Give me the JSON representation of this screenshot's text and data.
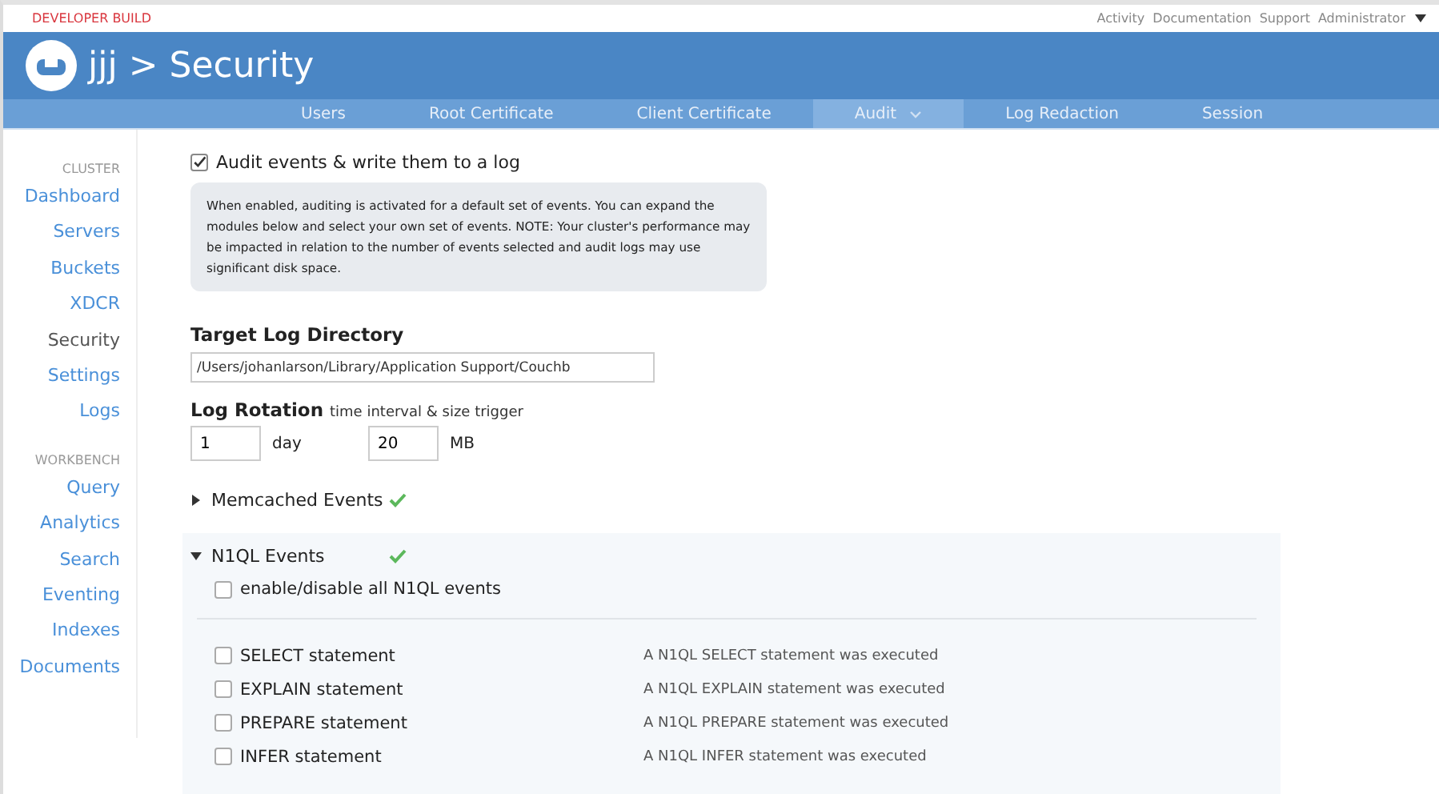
{
  "top_bar": {
    "badge": "DEVELOPER BUILD",
    "links": [
      "Activity",
      "Documentation",
      "Support",
      "Administrator"
    ]
  },
  "header": {
    "title": "jjj > Security"
  },
  "tabs": [
    {
      "label": "Users",
      "selected": false,
      "dropdown": false
    },
    {
      "label": "Root Certificate",
      "selected": false,
      "dropdown": false
    },
    {
      "label": "Client Certificate",
      "selected": false,
      "dropdown": false
    },
    {
      "label": "Audit",
      "selected": true,
      "dropdown": true
    },
    {
      "label": "Log Redaction",
      "selected": false,
      "dropdown": false
    },
    {
      "label": "Session",
      "selected": false,
      "dropdown": false
    }
  ],
  "sidebar": {
    "groups": [
      {
        "heading": "CLUSTER",
        "items": [
          {
            "label": "Dashboard",
            "selected": false
          },
          {
            "label": "Servers",
            "selected": false
          },
          {
            "label": "Buckets",
            "selected": false
          },
          {
            "label": "XDCR",
            "selected": false
          },
          {
            "label": "Security",
            "selected": true
          },
          {
            "label": "Settings",
            "selected": false
          },
          {
            "label": "Logs",
            "selected": false
          }
        ]
      },
      {
        "heading": "WORKBENCH",
        "items": [
          {
            "label": "Query",
            "selected": false
          },
          {
            "label": "Analytics",
            "selected": false
          },
          {
            "label": "Search",
            "selected": false
          },
          {
            "label": "Eventing",
            "selected": false
          },
          {
            "label": "Indexes",
            "selected": false
          },
          {
            "label": "Documents",
            "selected": false
          }
        ]
      }
    ]
  },
  "audit": {
    "label": "Audit events & write them to a log",
    "checked": true,
    "note": "When enabled, auditing is activated for a default set of events. You can expand the modules below and select your own set of events. NOTE: Your cluster's performance may be impacted in relation to the number of events selected and audit logs may use significant disk space."
  },
  "target_log_directory": {
    "label": "Target Log Directory",
    "value": "/Users/johanlarson/Library/Application Support/Couchb"
  },
  "log_rotation": {
    "label": "Log Rotation",
    "hint": "time interval & size trigger",
    "interval": "1",
    "interval_unit": "day",
    "size": "20",
    "size_unit": "MB"
  },
  "modules": [
    {
      "name": "Memcached Events",
      "expanded": false,
      "valid": true
    },
    {
      "name": "N1QL Events",
      "expanded": true,
      "valid": true,
      "toggle_all": {
        "label": "enable/disable all N1QL events",
        "checked": false
      },
      "events": [
        {
          "name": "SELECT statement",
          "description": "A N1QL SELECT statement was executed",
          "checked": false
        },
        {
          "name": "EXPLAIN statement",
          "description": "A N1QL EXPLAIN statement was executed",
          "checked": false
        },
        {
          "name": "PREPARE statement",
          "description": "A N1QL PREPARE statement was executed",
          "checked": false
        },
        {
          "name": "INFER statement",
          "description": "A N1QL INFER statement was executed",
          "checked": false
        }
      ]
    }
  ]
}
